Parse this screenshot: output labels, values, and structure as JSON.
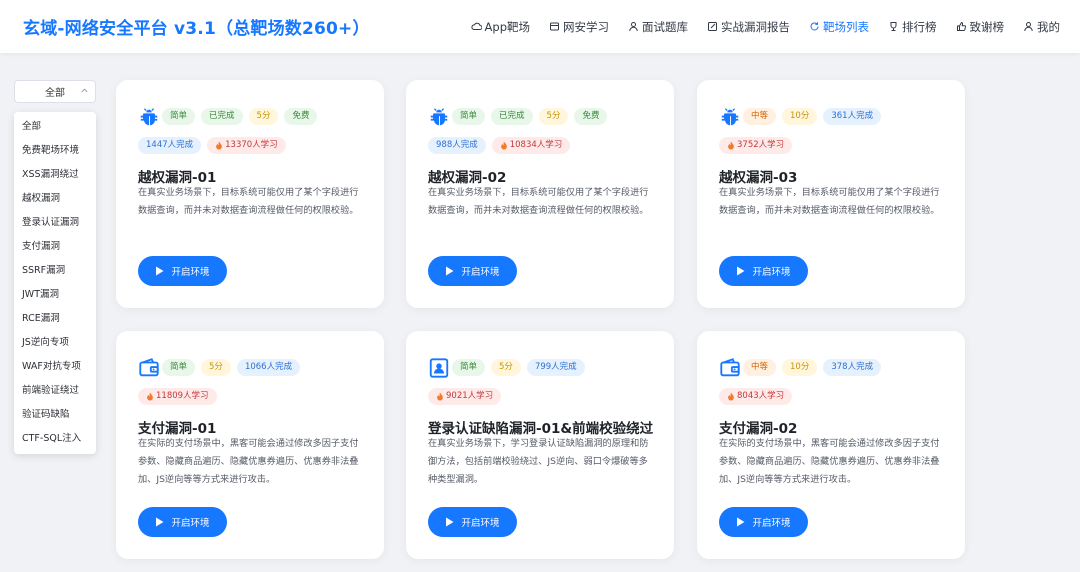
{
  "brand": "玄域-网络安全平台 v3.1（总靶场数260+）",
  "nav": [
    {
      "label": "App靶场",
      "icon": "cloud-icon",
      "active": false
    },
    {
      "label": "网安学习",
      "icon": "book-icon",
      "active": false
    },
    {
      "label": "面试题库",
      "icon": "user-icon",
      "active": false
    },
    {
      "label": "实战漏洞报告",
      "icon": "edit-icon",
      "active": false
    },
    {
      "label": "靶场列表",
      "icon": "refresh-icon",
      "active": true
    },
    {
      "label": "排行榜",
      "icon": "trophy-icon",
      "active": false
    },
    {
      "label": "致谢榜",
      "icon": "thumb-up-icon",
      "active": false
    },
    {
      "label": "我的",
      "icon": "user-icon",
      "active": false
    }
  ],
  "filter": {
    "selected": "全部",
    "options": [
      "全部",
      "免费靶场环境",
      "XSS漏洞绕过",
      "越权漏洞",
      "登录认证漏洞",
      "支付漏洞",
      "SSRF漏洞",
      "JWT漏洞",
      "RCE漏洞",
      "JS逆向专项",
      "WAF对抗专项",
      "前端验证绕过",
      "验证码缺陷",
      "CTF-SQL注入"
    ]
  },
  "colors": {
    "accent": "#1677ff",
    "background": "#f0f2f5"
  },
  "cards": [
    {
      "icon": "bug-icon",
      "tags": [
        {
          "text": "简单",
          "style": "green"
        },
        {
          "text": "已完成",
          "style": "green"
        },
        {
          "text": "5分",
          "style": "yellow"
        },
        {
          "text": "免费",
          "style": "green"
        },
        {
          "text": "1447人完成",
          "style": "blue"
        },
        {
          "text": "13370人学习",
          "style": "red"
        }
      ],
      "title": "越权漏洞-01",
      "desc": "在真实业务场景下，目标系统可能仅用了某个字段进行数据查询，而并未对数据查询流程做任何的权限校验。",
      "button": "开启环境"
    },
    {
      "icon": "bug-icon",
      "tags": [
        {
          "text": "简单",
          "style": "green"
        },
        {
          "text": "已完成",
          "style": "green"
        },
        {
          "text": "5分",
          "style": "yellow"
        },
        {
          "text": "免费",
          "style": "green"
        },
        {
          "text": "988人完成",
          "style": "blue"
        },
        {
          "text": "10834人学习",
          "style": "red"
        }
      ],
      "title": "越权漏洞-02",
      "desc": "在真实业务场景下，目标系统可能仅用了某个字段进行数据查询，而并未对数据查询流程做任何的权限校验。",
      "button": "开启环境"
    },
    {
      "icon": "bug-icon",
      "tags": [
        {
          "text": "中等",
          "style": "orange"
        },
        {
          "text": "10分",
          "style": "yellow"
        },
        {
          "text": "361人完成",
          "style": "blue"
        },
        {
          "text": "3752人学习",
          "style": "red"
        }
      ],
      "title": "越权漏洞-03",
      "desc": "在真实业务场景下，目标系统可能仅用了某个字段进行数据查询，而并未对数据查询流程做任何的权限校验。",
      "button": "开启环境"
    },
    {
      "icon": "wallet-icon",
      "tags": [
        {
          "text": "简单",
          "style": "green"
        },
        {
          "text": "5分",
          "style": "yellow"
        },
        {
          "text": "1066人完成",
          "style": "blue"
        },
        {
          "text": "11809人学习",
          "style": "red"
        }
      ],
      "title": "支付漏洞-01",
      "desc": "在实际的支付场景中，黑客可能会通过修改多因子支付参数、隐藏商品遍历、隐藏优惠券遍历、优惠券非法叠加、JS逆向等等方式来进行攻击。",
      "button": "开启环境"
    },
    {
      "icon": "id-card-icon",
      "tags": [
        {
          "text": "简单",
          "style": "green"
        },
        {
          "text": "5分",
          "style": "yellow"
        },
        {
          "text": "799人完成",
          "style": "blue"
        },
        {
          "text": "9021人学习",
          "style": "red"
        }
      ],
      "title": "登录认证缺陷漏洞-01&前端校验绕过",
      "desc": "在真实业务场景下，学习登录认证缺陷漏洞的原理和防御方法，包括前端校验绕过、JS逆向、弱口令爆破等多种类型漏洞。",
      "button": "开启环境"
    },
    {
      "icon": "wallet-icon",
      "tags": [
        {
          "text": "中等",
          "style": "orange"
        },
        {
          "text": "10分",
          "style": "yellow"
        },
        {
          "text": "378人完成",
          "style": "blue"
        },
        {
          "text": "8043人学习",
          "style": "red"
        }
      ],
      "title": "支付漏洞-02",
      "desc": "在实际的支付场景中，黑客可能会通过修改多因子支付参数、隐藏商品遍历、隐藏优惠券遍历、优惠券非法叠加、JS逆向等等方式来进行攻击。",
      "button": "开启环境"
    }
  ]
}
